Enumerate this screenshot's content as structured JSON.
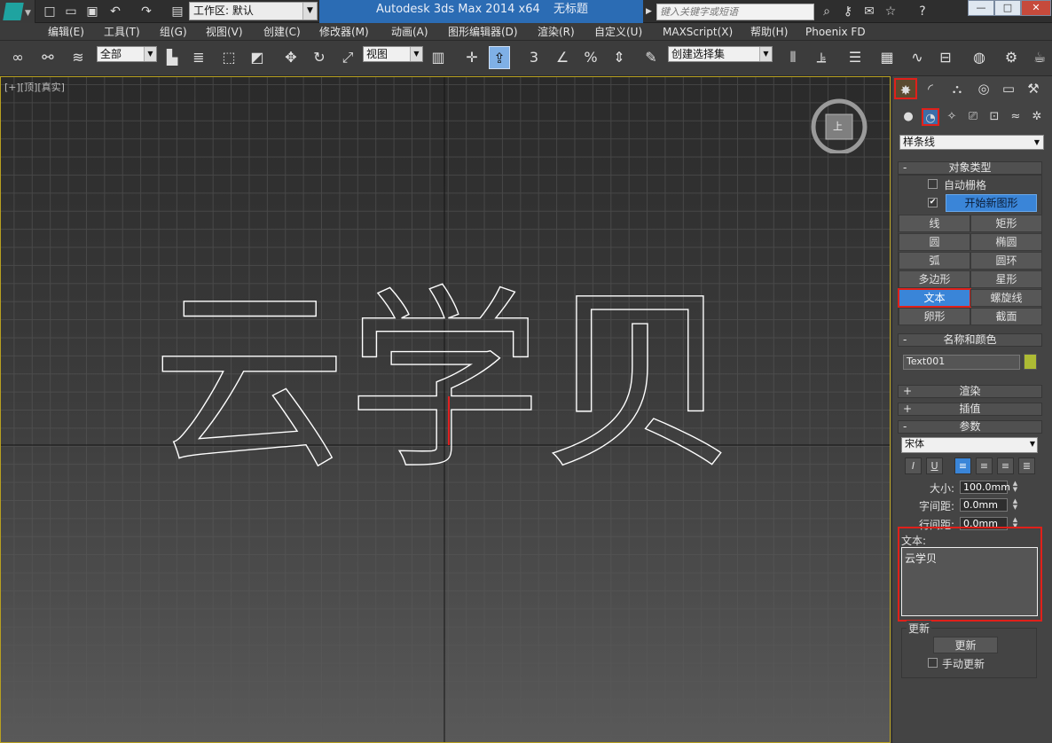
{
  "app": {
    "title": "Autodesk 3ds Max  2014 x64",
    "file": "无标题",
    "workspace": "工作区: 默认",
    "search_placeholder": "键入关键字或短语"
  },
  "menu": [
    "编辑(E)",
    "工具(T)",
    "组(G)",
    "视图(V)",
    "创建(C)",
    "修改器(M)",
    "动画(A)",
    "图形编辑器(D)",
    "渲染(R)",
    "自定义(U)",
    "MAXScript(X)",
    "帮助(H)",
    "Phoenix FD"
  ],
  "toolbar": {
    "selection_filter": "全部",
    "ref_coord": "视图",
    "named_selection": "创建选择集"
  },
  "viewport": {
    "label": "[+][顶][真实]",
    "shape_text": "云学贝",
    "viewcube_label": "上"
  },
  "panel": {
    "category_dropdown": "样条线",
    "object_type": {
      "title": "对象类型",
      "autogrid": "自动栅格",
      "start_new_shape": "开始新图形",
      "buttons": [
        [
          "线",
          "矩形"
        ],
        [
          "圆",
          "椭圆"
        ],
        [
          "弧",
          "圆环"
        ],
        [
          "多边形",
          "星形"
        ],
        [
          "文本",
          "螺旋线"
        ],
        [
          "卵形",
          "截面"
        ]
      ]
    },
    "name_color": {
      "title": "名称和颜色",
      "name": "Text001",
      "color": "#adbb34"
    },
    "rollouts": {
      "render": "渲染",
      "interpolation": "插值",
      "parameters": "参数"
    },
    "params": {
      "font": "宋体",
      "size_label": "大小:",
      "size": "100.0mm",
      "kerning_label": "字间距:",
      "kerning": "0.0mm",
      "leading_label": "行间距:",
      "leading": "0.0mm",
      "text_label": "文本:",
      "text": "云学贝"
    },
    "update": {
      "group": "更新",
      "button": "更新",
      "manual": "手动更新"
    }
  }
}
